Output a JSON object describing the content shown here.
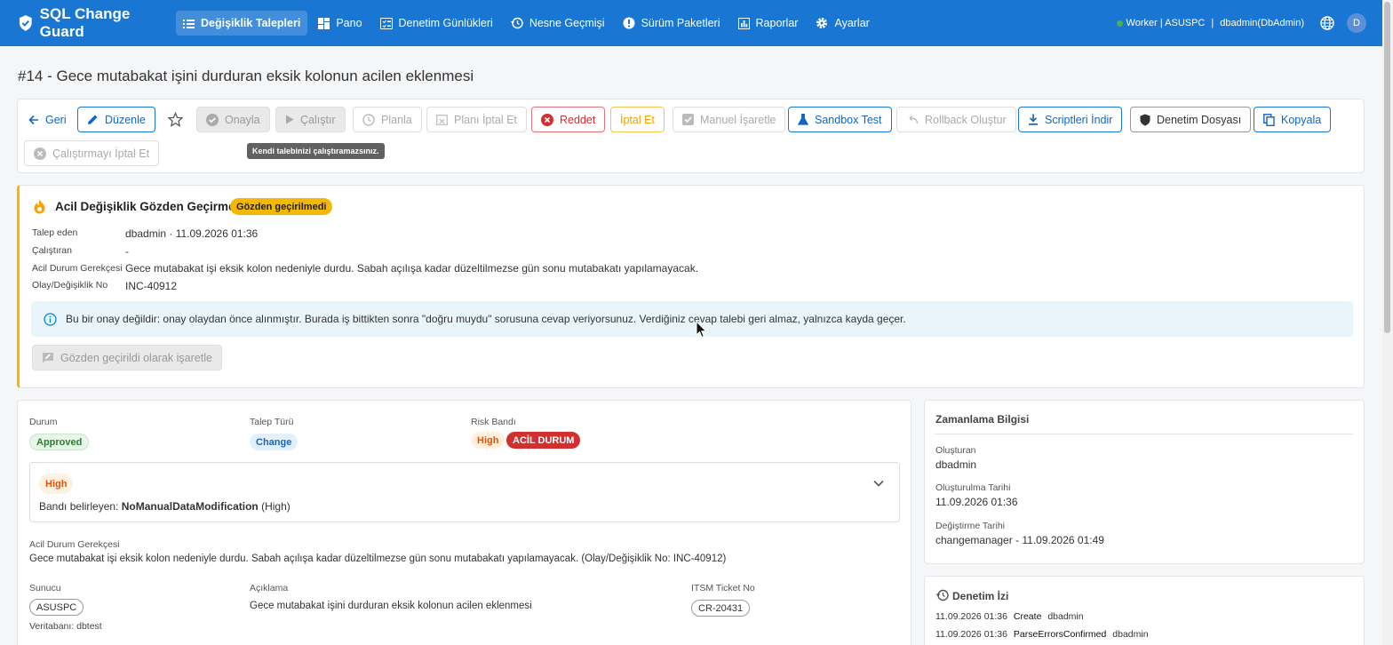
{
  "app": {
    "title": "SQL Change Guard"
  },
  "nav": {
    "items": [
      {
        "label": "Değişiklik Talepleri",
        "active": true
      },
      {
        "label": "Pano"
      },
      {
        "label": "Denetim Günlükleri"
      },
      {
        "label": "Nesne Geçmişi"
      },
      {
        "label": "Sürüm Paketleri"
      },
      {
        "label": "Raporlar"
      },
      {
        "label": "Ayarlar"
      }
    ],
    "worker": "Worker | ASUSPC",
    "sep": "|",
    "user": "dbadmin(DbAdmin)",
    "avatar": "D"
  },
  "page": {
    "title": "#14 - Gece mutabakat işini durduran eksik kolonun acilen eklenmesi"
  },
  "toolbar": {
    "back": "Geri",
    "edit": "Düzenle",
    "approve": "Onayla",
    "run": "Çalıştır",
    "plan": "Planla",
    "cancel_plan": "Planı İptal Et",
    "reject": "Reddet",
    "cancel": "İptal Et",
    "manual_mark": "Manuel İşaretle",
    "sandbox": "Sandbox Test",
    "rollback": "Rollback Oluştur",
    "download": "Scriptleri İndir",
    "audit_file": "Denetim Dosyası",
    "copy": "Kopyala",
    "cancel_run": "Çalıştırmayı İptal Et",
    "tooltip": "Kendi talebinizi çalıştıramazsınız."
  },
  "emergency": {
    "title": "Acil Değişiklik Gözden Geçirme",
    "badge": "Gözden geçirilmedi",
    "fields": [
      {
        "label": "Talep eden",
        "value": "dbadmin · 11.09.2026 01:36"
      },
      {
        "label": "Çalıştıran",
        "value": "-"
      },
      {
        "label": "Acil Durum Gerekçesi",
        "value": "Gece mutabakat işi eksik kolon nedeniyle durdu. Sabah açılışa kadar düzeltilmezse gün sonu mutabakatı yapılamayacak."
      },
      {
        "label": "Olay/Değişiklik No",
        "value": "INC-40912"
      }
    ],
    "info": "Bu bir onay değildir: onay olaydan önce alınmıştır. Burada iş bittikten sonra \"doğru muydu\" sorusuna cevap veriyorsunuz. Verdiğiniz cevap talebi geri almaz, yalnızca kayda geçer.",
    "mark_button": "Gözden geçirildi olarak işaretle"
  },
  "details": {
    "status_label": "Durum",
    "status": "Approved",
    "type_label": "Talep Türü",
    "type": "Change",
    "risk_label": "Risk Bandı",
    "risk": "High",
    "emergency_chip": "ACİL DURUM",
    "risk_box": {
      "chip": "High",
      "prefix": "Bandı belirleyen:",
      "rule": "NoManualDataModification",
      "suffix": "(High)"
    },
    "reason_label": "Acil Durum Gerekçesi",
    "reason": "Gece mutabakat işi eksik kolon nedeniyle durdu. Sabah açılışa kadar düzeltilmezse gün sonu mutabakatı yapılamayacak. (Olay/Değişiklik No: INC-40912)",
    "server_label": "Sunucu",
    "server": "ASUSPC",
    "desc_label": "Açıklama",
    "desc": "Gece mutabakat işini durduran eksik kolonun acilen eklenmesi",
    "itsm_label": "ITSM Ticket No",
    "itsm": "CR-20431",
    "db": "Veritabanı: dbtest"
  },
  "timing": {
    "title": "Zamanlama Bilgisi",
    "creator_label": "Oluşturan",
    "creator": "dbadmin",
    "created_label": "Oluşturulma Tarihi",
    "created": "11.09.2026 01:36",
    "modified_label": "Değiştirme Tarihi",
    "modified": "changemanager - 11.09.2026 01:49"
  },
  "audit": {
    "title": "Denetim İzi",
    "rows": [
      {
        "time": "11.09.2026 01:36",
        "action": "Create",
        "user": "dbadmin"
      },
      {
        "time": "11.09.2026 01:36",
        "action": "ParseErrorsConfirmed",
        "user": "dbadmin"
      }
    ]
  },
  "colors": {
    "primary": "#1976d2",
    "danger": "#d32f2f",
    "warning": "#f5b800",
    "success": "#2e7d32"
  }
}
